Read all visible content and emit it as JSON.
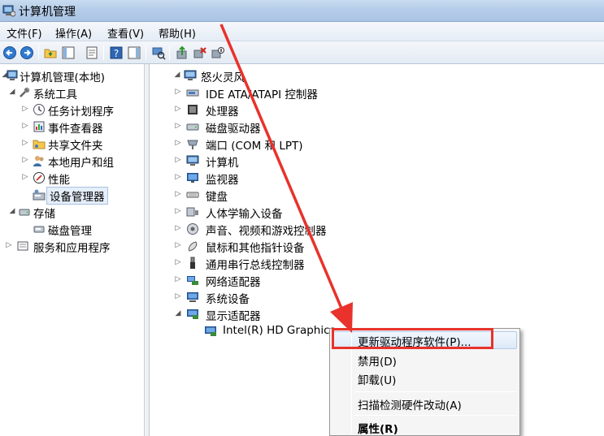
{
  "window": {
    "title": "计算机管理"
  },
  "menu": [
    "文件(F)",
    "操作(A)",
    "查看(V)",
    "帮助(H)"
  ],
  "toolbar": {
    "buttons": [
      "back-icon",
      "forward-icon",
      "up-folder-icon",
      "show-tree-icon",
      "properties-icon",
      "help-icon",
      "action-pane-icon",
      "scan-hardware-icon",
      "update-driver-icon",
      "uninstall-icon",
      "disable-icon"
    ]
  },
  "left_tree": {
    "root": "计算机管理(本地)",
    "system_tools": "系统工具",
    "task_scheduler": "任务计划程序",
    "event_viewer": "事件查看器",
    "shared_folders": "共享文件夹",
    "local_users": "本地用户和组",
    "performance": "性能",
    "device_manager": "设备管理器",
    "storage": "存储",
    "disk_management": "磁盘管理",
    "services_apps": "服务和应用程序"
  },
  "device_tree": {
    "computer_name": "怒火灵风",
    "categories": [
      "IDE ATA/ATAPI 控制器",
      "处理器",
      "磁盘驱动器",
      "端口 (COM 和 LPT)",
      "计算机",
      "监视器",
      "键盘",
      "人体学输入设备",
      "声音、视频和游戏控制器",
      "鼠标和其他指针设备",
      "通用串行总线控制器",
      "网络适配器",
      "系统设备",
      "显示适配器"
    ],
    "display_child": "Intel(R) HD Graphics"
  },
  "context_menu": {
    "update_driver": "更新驱动程序软件(P)...",
    "disable": "禁用(D)",
    "uninstall": "卸载(U)",
    "scan": "扫描检测硬件改动(A)",
    "properties": "属性(R)"
  },
  "colors": {
    "annotation_red": "#e8322b",
    "titlebar": "#b5cde9"
  }
}
